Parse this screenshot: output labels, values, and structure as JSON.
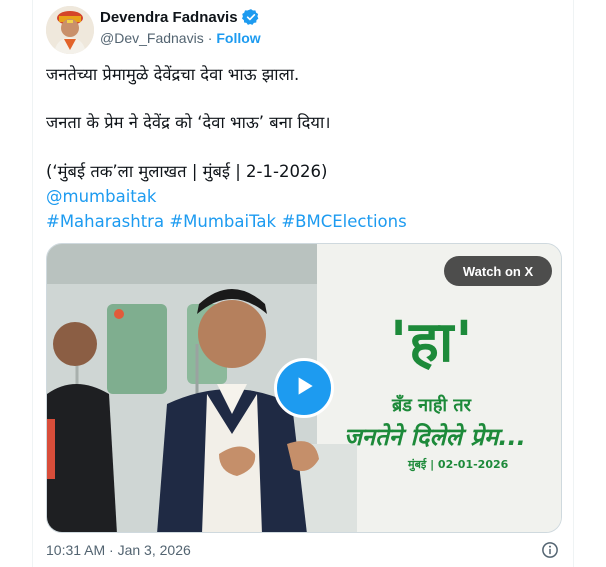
{
  "author": {
    "name": "Devendra Fadnavis",
    "handle": "@Dev_Fadnavis",
    "separator": "·",
    "follow_label": "Follow",
    "verified": true
  },
  "tweet": {
    "line1": "जनतेच्या प्रेमामुळे देवेंद्रचा देवा भाऊ झाला.",
    "line2": "जनता के प्रेम ने देवेंद्र को ‘देवा भाऊ’ बना दिया।",
    "line3": "(‘मुंबई तक’ला मुलाखत | मुंबई | 2-1-2026)",
    "mention": "@mumbaitak",
    "hashtags": [
      "#Maharashtra",
      "#MumbaiTak",
      "#BMCElections"
    ]
  },
  "media": {
    "watch_label": "Watch on X",
    "headline": "'हा'",
    "subline1": "ब्रँड नाही तर",
    "subline2": "जनतेने दिलेले प्रेम...",
    "date_caption": "मुंबई | 02-01-2026",
    "accent_color": "#1d8a3a"
  },
  "footer": {
    "timestamp": "10:31 AM · Jan 3, 2026"
  },
  "colors": {
    "link": "#1d9bf0",
    "secondary_text": "#536471",
    "primary_text": "#0f1419"
  }
}
